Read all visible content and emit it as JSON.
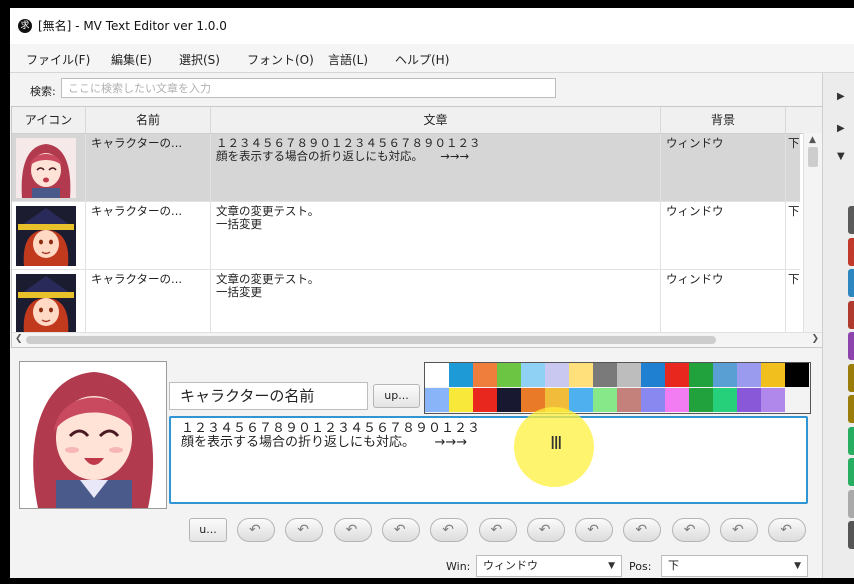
{
  "window": {
    "title": "[無名] - MV Text Editor ver 1.0.0",
    "app_icon_glyph": "求"
  },
  "menu": [
    "ファイル(F)",
    "編集(E)",
    "選択(S)",
    "フォント(O)",
    "言語(L)",
    "ヘルプ(H)"
  ],
  "search": {
    "label": "検索:",
    "placeholder": "ここに検索したい文章を入力",
    "value": ""
  },
  "table": {
    "headers": [
      "アイコン",
      "名前",
      "文章",
      "背景"
    ],
    "rows": [
      {
        "name": "キャラクターの...",
        "text": "１２３４５６７８９０１２３４５６７８９０１２３\n顔を表示する場合の折り返しにも対応。　　→→→",
        "background": "ウィンドウ",
        "pos": "下",
        "face": "pink-hair-girl-icon",
        "selected": true
      },
      {
        "name": "キャラクターの...",
        "text": "文章の変更テスト。\n一括変更",
        "background": "ウィンドウ",
        "pos": "下",
        "face": "witch-icon",
        "selected": false
      },
      {
        "name": "キャラクターの...",
        "text": "文章の変更テスト。\n一括変更",
        "background": "ウィンドウ",
        "pos": "下",
        "face": "witch-icon",
        "selected": false
      }
    ]
  },
  "editor": {
    "name_value": "キャラクターの名前",
    "name_button": "up...",
    "message_text": "１２３４５６７８９０１２３４５６７８９０１２３\n顔を表示する場合の折り返しにも対応。　　→→→\n",
    "face_button": "u...",
    "win_label": "Win:",
    "win_value": "ウィンドウ",
    "pos_label": "Pos:",
    "pos_value": "下"
  },
  "palette": [
    "#ffffff",
    "#1e9ad6",
    "#ef7d3b",
    "#6cc644",
    "#8fd0f5",
    "#c8c8f0",
    "#ffe07a",
    "#7a7a7a",
    "#bdbdbd",
    "#1f7fd0",
    "#e8281e",
    "#22a23c",
    "#5a9fd4",
    "#9a9aee",
    "#f2c01e",
    "#000000",
    "#8ab4f8",
    "#f7e83a",
    "#e8281e",
    "#181830",
    "#e87a28",
    "#f0bc3a",
    "#4fb0f0",
    "#86e888",
    "#c4807a",
    "#8888f0",
    "#f27cf2",
    "#22a23c",
    "#26d07a",
    "#8858d8",
    "#b088ec",
    ""
  ],
  "colors": {
    "accent": "#2f96d3",
    "selected_row": "#d6d6d6",
    "highlight": "#fff03c"
  },
  "right_panel": {
    "icons": [
      "#5a5a5a",
      "#c0392b",
      "#2e86c1",
      "#b03a2e",
      "#8e44ad",
      "#9a7d0a",
      "#9a7d0a",
      "#27ae60",
      "#27ae60",
      "#aaaaaa",
      "#555555"
    ]
  }
}
